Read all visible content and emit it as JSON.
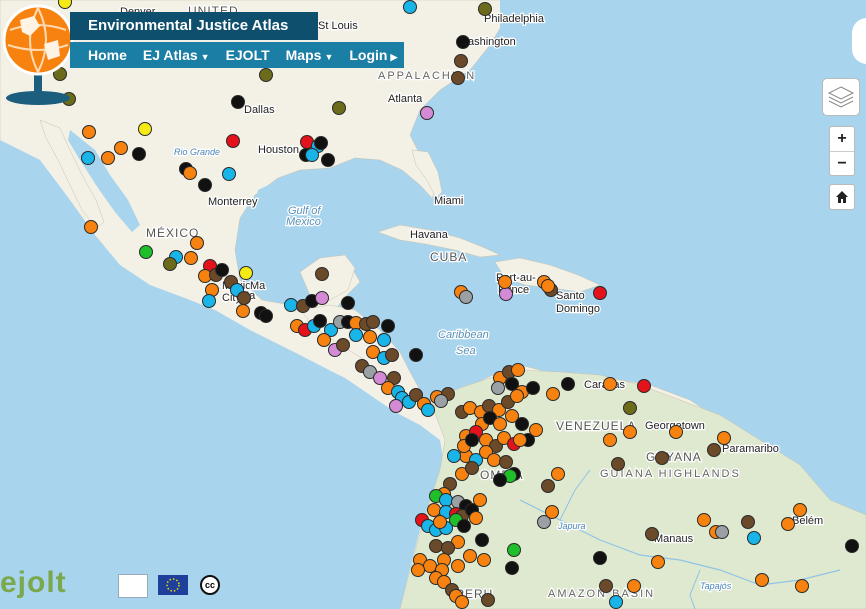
{
  "header": {
    "title": "Environmental Justice Atlas"
  },
  "nav": [
    {
      "label": "Home",
      "dropdown": false
    },
    {
      "label": "EJ Atlas",
      "dropdown": true
    },
    {
      "label": "EJOLT",
      "dropdown": false
    },
    {
      "label": "Maps",
      "dropdown": true
    },
    {
      "label": "Login",
      "dropdown": false,
      "arrow": true
    }
  ],
  "controls": {
    "zoom_in": "+",
    "zoom_out": "−",
    "home_icon": "home-icon",
    "layers_icon": "layers-icon"
  },
  "footer": {
    "ejolt_logo": "ejolt",
    "cc_text": "cc"
  },
  "colors": {
    "water": "#a8d4ee",
    "land": "#f3f0e6",
    "forest": "#dfe9cf",
    "marker_orange": "#f7820f",
    "marker_black": "#111111",
    "marker_brown": "#6b4a2a",
    "marker_gray": "#9aa0a3",
    "marker_blue": "#19b4e8",
    "marker_red": "#e3121b",
    "marker_olive": "#6b6b1b",
    "marker_pink": "#d48bd6",
    "marker_green": "#1fbf2a",
    "marker_yellow": "#f5ea14",
    "header_bg": "#0f4f6e",
    "nav_bg": "#1b7ea4"
  },
  "map_labels": [
    {
      "text": "UNITED",
      "kind": "country"
    },
    {
      "text": "Denver",
      "kind": "city"
    },
    {
      "text": "St Louis",
      "kind": "city"
    },
    {
      "text": "Philadelphia",
      "kind": "city"
    },
    {
      "text": "Washington",
      "kind": "city"
    },
    {
      "text": "Dallas",
      "kind": "city"
    },
    {
      "text": "Atlanta",
      "kind": "city"
    },
    {
      "text": "Houston",
      "kind": "city"
    },
    {
      "text": "Rio Grande",
      "kind": "river"
    },
    {
      "text": "Monterrey",
      "kind": "city"
    },
    {
      "text": "Gulf of",
      "kind": "water"
    },
    {
      "text": "Mexico",
      "kind": "water"
    },
    {
      "text": "Miami",
      "kind": "city"
    },
    {
      "text": "MÉXICO",
      "kind": "country"
    },
    {
      "text": "Havana",
      "kind": "city"
    },
    {
      "text": "CUBA",
      "kind": "country"
    },
    {
      "text": "Port-au-",
      "kind": "city"
    },
    {
      "text": "Prince",
      "kind": "city"
    },
    {
      "text": "Santo",
      "kind": "city"
    },
    {
      "text": "Domingo",
      "kind": "city"
    },
    {
      "text": "Caribbean",
      "kind": "water"
    },
    {
      "text": "Sea",
      "kind": "water"
    },
    {
      "text": "Caracas",
      "kind": "city"
    },
    {
      "text": "VENEZUELA",
      "kind": "country"
    },
    {
      "text": "Georgetown",
      "kind": "city"
    },
    {
      "text": "GUYANA",
      "kind": "country"
    },
    {
      "text": "Paramaribo",
      "kind": "city"
    },
    {
      "text": "GUIANA HIGHLANDS",
      "kind": "region"
    },
    {
      "text": "OMBIA",
      "kind": "country"
    },
    {
      "text": "Japura",
      "kind": "river"
    },
    {
      "text": "Manaus",
      "kind": "city"
    },
    {
      "text": "Belém",
      "kind": "city"
    },
    {
      "text": "Tapajós",
      "kind": "river"
    },
    {
      "text": "AMAZON BASIN",
      "kind": "region"
    },
    {
      "text": "PERU",
      "kind": "country"
    },
    {
      "text": "APPALACHIAN",
      "kind": "region"
    },
    {
      "text": "Mexico",
      "kind": "city"
    },
    {
      "text": "City",
      "kind": "city"
    },
    {
      "text": "Ma",
      "kind": "city"
    },
    {
      "text": "Ma",
      "kind": "city"
    }
  ]
}
